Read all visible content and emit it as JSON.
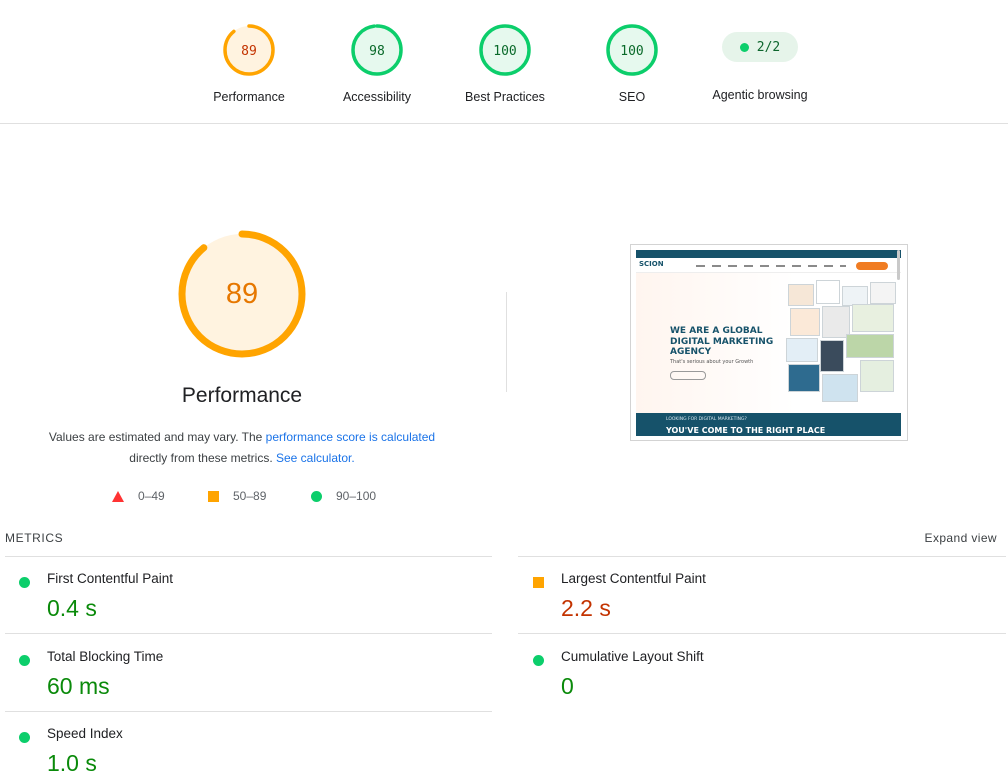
{
  "categories": [
    {
      "score": "89",
      "label": "Performance",
      "status": "average",
      "fraction": 0.89
    },
    {
      "score": "98",
      "label": "Accessibility",
      "status": "pass",
      "fraction": 0.98
    },
    {
      "score": "100",
      "label": "Best Practices",
      "status": "pass",
      "fraction": 1.0
    },
    {
      "score": "100",
      "label": "SEO",
      "status": "pass",
      "fraction": 1.0
    }
  ],
  "agentic": {
    "value": "2/2",
    "label": "Agentic browsing"
  },
  "performance": {
    "score": "89",
    "title": "Performance",
    "desc_prefix": "Values are estimated and may vary. The ",
    "desc_link": "performance score is calculated",
    "desc_middle": "directly from these metrics. ",
    "desc_link2": "See calculator.",
    "legend": [
      {
        "range": "0–49",
        "shape": "triangle",
        "color": "#ff3333"
      },
      {
        "range": "50–89",
        "shape": "square",
        "color": "#ffa400"
      },
      {
        "range": "90–100",
        "shape": "circle",
        "color": "#0cce6b"
      }
    ]
  },
  "thumbnail": {
    "logo": "SCION",
    "headline": [
      "WE ARE A GLOBAL",
      "DIGITAL MARKETING",
      "AGENCY"
    ],
    "subline": "That's serious about your Growth",
    "footer_small": "LOOKING FOR DIGITAL MARKETING?",
    "footer_big": "YOU'VE COME TO THE RIGHT PLACE"
  },
  "metrics": {
    "heading": "METRICS",
    "expand": "Expand view",
    "items": [
      {
        "name": "First Contentful Paint",
        "value": "0.4 s",
        "status": "pass"
      },
      {
        "name": "Largest Contentful Paint",
        "value": "2.2 s",
        "status": "average"
      },
      {
        "name": "Total Blocking Time",
        "value": "60 ms",
        "status": "pass"
      },
      {
        "name": "Cumulative Layout Shift",
        "value": "0",
        "status": "pass"
      },
      {
        "name": "Speed Index",
        "value": "1.0 s",
        "status": "pass"
      }
    ]
  },
  "colors": {
    "pass": "#0cce6b",
    "pass_text": "#0a8a0a",
    "pass_bg": "#e6f9ee",
    "average": "#ffa400",
    "average_text": "#c33300",
    "average_bg": "#fff3e0",
    "fail": "#ff3333"
  }
}
